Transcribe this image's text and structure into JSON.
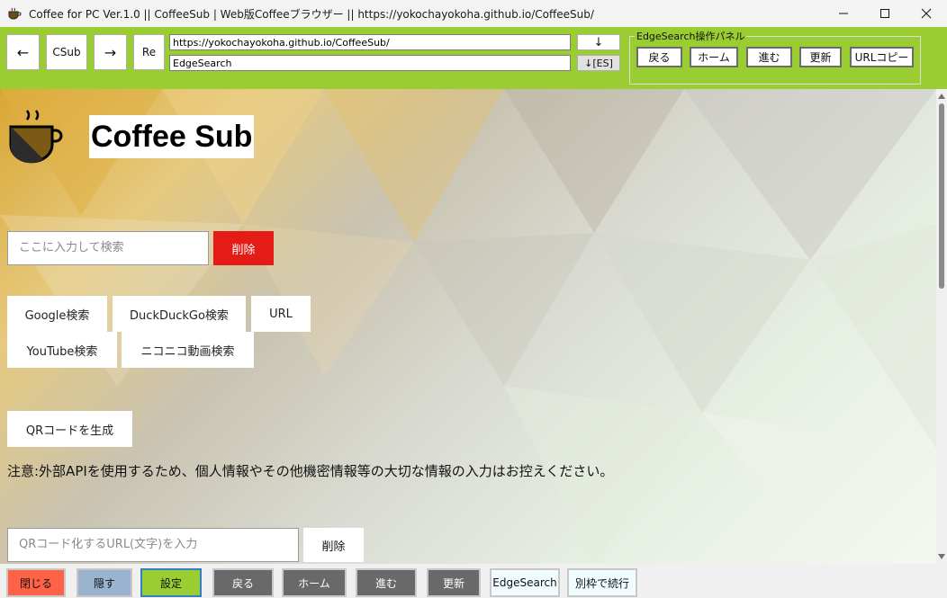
{
  "window": {
    "title": "Coffee for PC Ver.1.0  ||  CoffeeSub | Web版Coffeeブラウザー  ||  https://yokochayokoha.github.io/CoffeeSub/",
    "app_icon": "coffee-cup-icon",
    "controls": [
      "minimize-icon",
      "maximize-icon",
      "close-icon"
    ]
  },
  "toolbar": {
    "back_label": "←",
    "csub_label": "CSub",
    "forward_label": "→",
    "reload_label": "Re",
    "url_value": "https://yokochayokoha.github.io/CoffeeSub/",
    "search_value": "EdgeSearch",
    "down_label": "↓",
    "down_es_label": "↓[ES]",
    "accent_color": "#9acd32",
    "edge_panel": {
      "legend": "EdgeSearch操作パネル",
      "back": "戻る",
      "home": "ホーム",
      "forward": "進む",
      "refresh": "更新",
      "copy_url": "URLコピー"
    }
  },
  "page": {
    "site_title": "Coffee Sub",
    "logo_icon": "coffee-cup-icon",
    "search": {
      "placeholder": "ここに入力して検索",
      "delete_label": "削除",
      "delete_color": "#e41b17"
    },
    "search_buttons": {
      "google": "Google検索",
      "duckduckgo": "DuckDuckGo検索",
      "url": "URL",
      "youtube": "YouTube検索",
      "niconico": "ニコニコ動画検索"
    },
    "qr_generate_label": "QRコードを生成",
    "notice": "注意:外部APIを使用するため、個人情報やその他機密情報等の大切な情報の入力はお控えください。",
    "qr_input_placeholder": "QRコード化するURL(文字)を入力",
    "qr_delete_label": "削除"
  },
  "bottombar": {
    "close": "閉じる",
    "hide": "隠す",
    "settings": "設定",
    "back": "戻る",
    "home": "ホーム",
    "forward": "進む",
    "refresh": "更新",
    "edgesearch": "EdgeSearch",
    "continue_separate": "別枠で続行",
    "colors": {
      "close": "#ff6347",
      "hide": "#9ab4d0",
      "settings": "#9acd32",
      "nav": "#696969",
      "light": "#f0fcff"
    }
  }
}
